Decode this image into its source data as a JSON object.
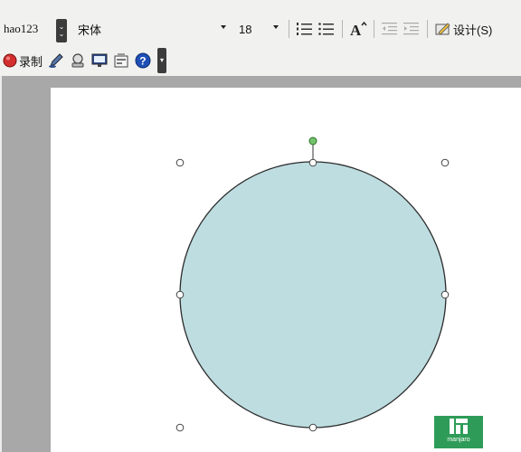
{
  "toolbar": {
    "style_value": "hao123",
    "font_value": "宋体",
    "size_value": "18",
    "design_label": "设计(S)",
    "record_label": "录制"
  },
  "icons": [
    "numbered-list-icon",
    "bullet-list-icon",
    "increase-font-icon",
    "decrease-indent-icon",
    "increase-indent-icon",
    "design-icon",
    "record-icon",
    "pen-icon",
    "speaker-icon",
    "slide-show-icon",
    "new-slide-icon",
    "help-icon"
  ],
  "colors": {
    "circle_fill": "#bedde1",
    "circle_stroke": "#2b2b2b",
    "rotate_handle": "#73c46b",
    "record_red": "#d32f2f",
    "help_blue": "#1e4fb5",
    "logo_green": "#2e9c58"
  },
  "logo": {
    "text": "manjaro"
  }
}
